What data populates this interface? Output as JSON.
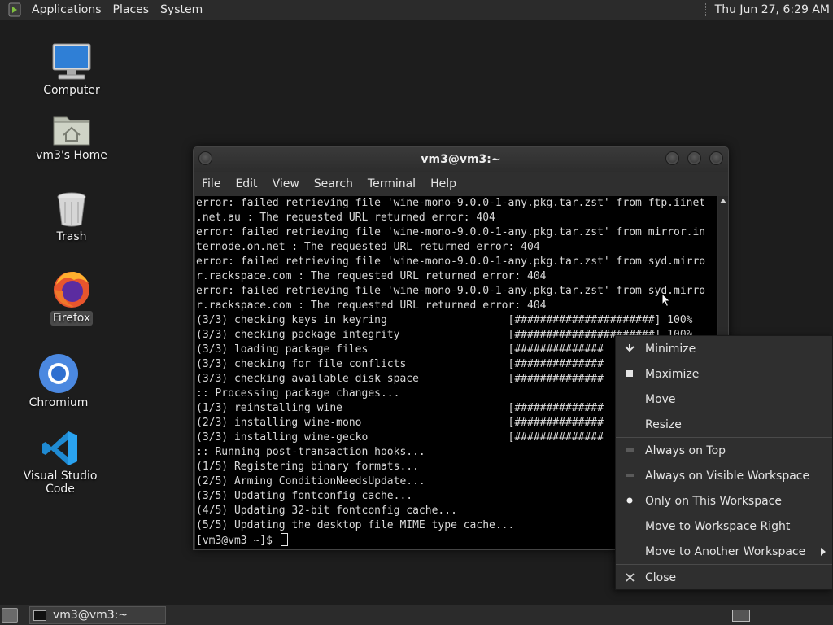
{
  "top_panel": {
    "menus": [
      "Applications",
      "Places",
      "System"
    ],
    "clock": "Thu Jun 27,  6:29 AM"
  },
  "desktop_icons": [
    {
      "label": "Computer",
      "icon": "computer-icon"
    },
    {
      "label": "vm3's Home",
      "icon": "home-folder-icon"
    },
    {
      "label": "Trash",
      "icon": "trash-icon"
    },
    {
      "label": "Firefox",
      "icon": "firefox-icon"
    },
    {
      "label": "Chromium",
      "icon": "chromium-icon"
    },
    {
      "label": "Visual Studio Code",
      "icon": "vscode-icon"
    }
  ],
  "terminal": {
    "title": "vm3@vm3:~",
    "menus": [
      "File",
      "Edit",
      "View",
      "Search",
      "Terminal",
      "Help"
    ],
    "lines": [
      "error: failed retrieving file 'wine-mono-9.0.0-1-any.pkg.tar.zst' from ftp.iinet",
      ".net.au : The requested URL returned error: 404",
      "error: failed retrieving file 'wine-mono-9.0.0-1-any.pkg.tar.zst' from mirror.in",
      "ternode.on.net : The requested URL returned error: 404",
      "error: failed retrieving file 'wine-mono-9.0.0-1-any.pkg.tar.zst' from syd.mirro",
      "r.rackspace.com : The requested URL returned error: 404",
      "error: failed retrieving file 'wine-mono-9.0.0-1-any.pkg.tar.zst' from syd.mirro",
      "r.rackspace.com : The requested URL returned error: 404",
      "(3/3) checking keys in keyring                   [######################] 100%",
      "(3/3) checking package integrity                 [######################] 100%",
      "(3/3) loading package files                      [##############",
      "(3/3) checking for file conflicts                [##############",
      "(3/3) checking available disk space              [##############",
      ":: Processing package changes...",
      "(1/3) reinstalling wine                          [##############",
      "(2/3) installing wine-mono                       [##############",
      "(3/3) installing wine-gecko                      [##############",
      ":: Running post-transaction hooks...",
      "(1/5) Registering binary formats...",
      "(2/5) Arming ConditionNeedsUpdate...",
      "(3/5) Updating fontconfig cache...",
      "(4/5) Updating 32-bit fontconfig cache...",
      "(5/5) Updating the desktop file MIME type cache..."
    ],
    "prompt": "[vm3@vm3 ~]$ "
  },
  "context_menu": {
    "items": [
      {
        "label": "Minimize",
        "icon": "minimize-icon",
        "glyph": "⌄"
      },
      {
        "label": "Maximize",
        "icon": "maximize-icon",
        "glyph": "■"
      },
      {
        "label": "Move",
        "icon": "",
        "glyph": ""
      },
      {
        "label": "Resize",
        "icon": "",
        "glyph": ""
      },
      {
        "label": "Always on Top",
        "icon": "radio-off-icon",
        "glyph": "▬"
      },
      {
        "label": "Always on Visible Workspace",
        "icon": "radio-off-icon",
        "glyph": "▬"
      },
      {
        "label": "Only on This Workspace",
        "icon": "radio-on-icon",
        "glyph": "●"
      },
      {
        "label": "Move to Workspace Right",
        "icon": "",
        "glyph": ""
      },
      {
        "label": "Move to Another Workspace",
        "icon": "",
        "glyph": "",
        "submenu": true
      },
      {
        "label": "Close",
        "icon": "close-icon",
        "glyph": "✕"
      }
    ]
  },
  "bottom_panel": {
    "task_label": "vm3@vm3:~"
  }
}
